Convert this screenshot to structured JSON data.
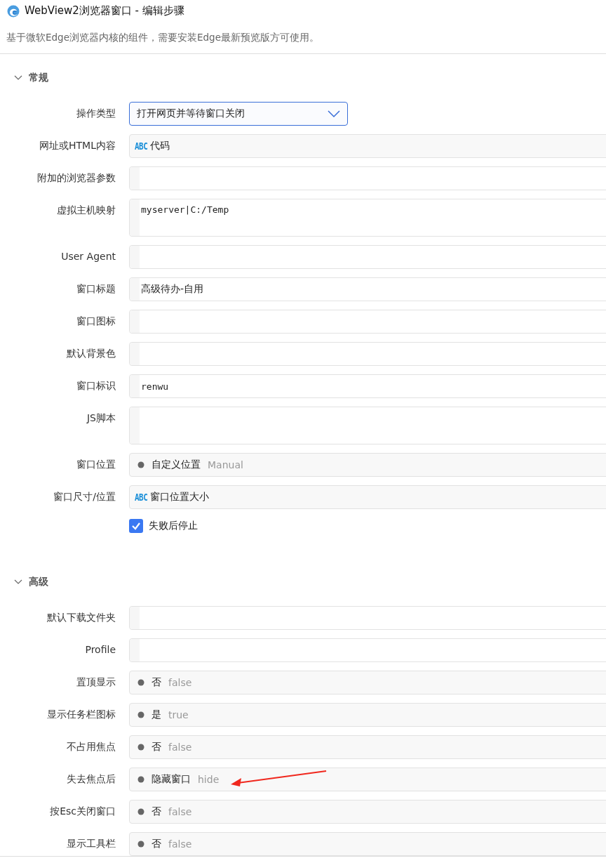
{
  "window": {
    "title": "WebView2浏览器窗口  -  编辑步骤"
  },
  "description": "基于微软Edge浏览器内核的组件，需要安装Edge最新预览版方可使用。",
  "sections": [
    {
      "title": "常规",
      "expanded": true,
      "rows": [
        {
          "kind": "select",
          "label": "操作类型",
          "value": "打开网页并等待窗口关闭"
        },
        {
          "kind": "expr",
          "label": "网址或HTML内容",
          "badge": "ABC",
          "value": "代码"
        },
        {
          "kind": "text",
          "label": "附加的浏览器参数"
        },
        {
          "kind": "multiline",
          "label": "虚拟主机映射",
          "value": "myserver|C:/Temp"
        },
        {
          "kind": "text",
          "label": "User Agent"
        },
        {
          "kind": "text",
          "label": "窗口标题",
          "value": "高级待办-自用"
        },
        {
          "kind": "text",
          "label": "窗口图标"
        },
        {
          "kind": "text",
          "label": "默认背景色"
        },
        {
          "kind": "text",
          "label": "窗口标识",
          "value": "renwu",
          "mono": true
        },
        {
          "kind": "multiline",
          "label": "JS脚本"
        },
        {
          "kind": "enum",
          "label": "窗口位置",
          "value": "自定义位置",
          "hint": "Manual"
        },
        {
          "kind": "expr",
          "label": "窗口尺寸/位置",
          "badge": "ABC",
          "value": "窗口位置大小"
        },
        {
          "kind": "checkbox",
          "label": "失败后停止",
          "checked": true
        }
      ]
    },
    {
      "title": "高级",
      "expanded": true,
      "rows": [
        {
          "kind": "text",
          "label": "默认下载文件夹"
        },
        {
          "kind": "text",
          "label": "Profile"
        },
        {
          "kind": "enum",
          "label": "置顶显示",
          "value": "否",
          "hint": "false"
        },
        {
          "kind": "enum",
          "label": "显示任务栏图标",
          "value": "是",
          "hint": "true"
        },
        {
          "kind": "enum",
          "label": "不占用焦点",
          "value": "否",
          "hint": "false"
        },
        {
          "kind": "enum",
          "label": "失去焦点后",
          "value": "隐藏窗口",
          "hint": "hide",
          "arrow_marked": true
        },
        {
          "kind": "enum",
          "label": "按Esc关闭窗口",
          "value": "否",
          "hint": "false"
        },
        {
          "kind": "enum",
          "label": "显示工具栏",
          "value": "否",
          "hint": "false"
        }
      ]
    }
  ]
}
